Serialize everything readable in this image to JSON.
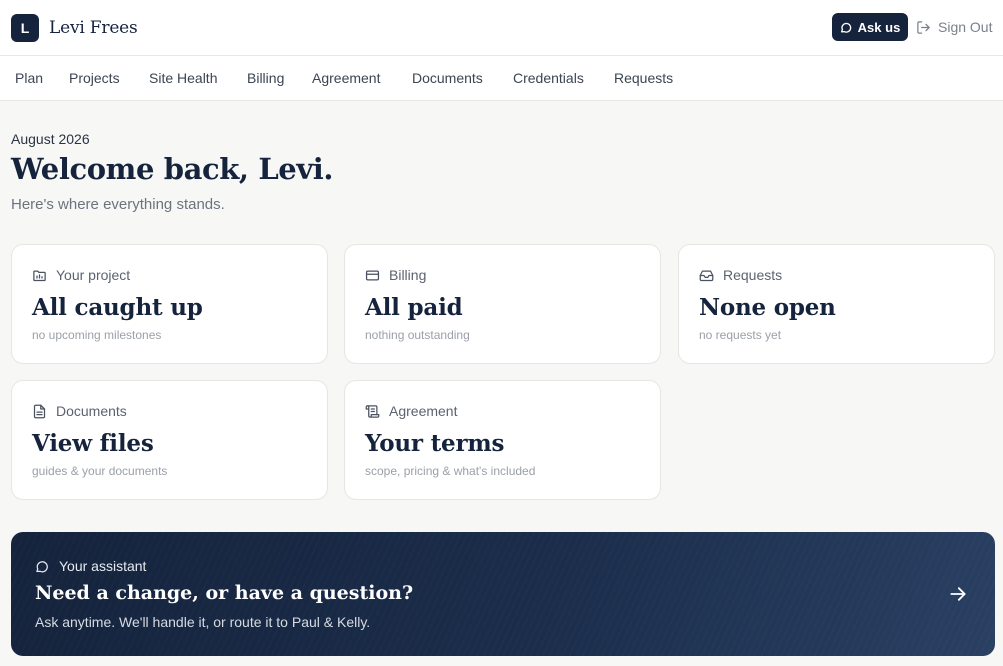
{
  "brand": {
    "initial": "L",
    "name": "Levi Frees"
  },
  "header": {
    "ask_label": "Ask us",
    "signout_label": "Sign Out"
  },
  "nav": [
    "Plan",
    "Projects",
    "Site Health",
    "Billing",
    "Agreement",
    "Documents",
    "Credentials",
    "Requests"
  ],
  "hero": {
    "date": "August 2026",
    "welcome": "Welcome back, Levi.",
    "subtitle": "Here's where everything stands."
  },
  "cards": [
    {
      "label": "Your project",
      "title": "All caught up",
      "sub": "no upcoming milestones",
      "icon": "folder-icon"
    },
    {
      "label": "Billing",
      "title": "All paid",
      "sub": "nothing outstanding",
      "icon": "credit-card-icon"
    },
    {
      "label": "Requests",
      "title": "None open",
      "sub": "no requests yet",
      "icon": "inbox-icon"
    },
    {
      "label": "Documents",
      "title": "View files",
      "sub": "guides & your documents",
      "icon": "document-icon"
    },
    {
      "label": "Agreement",
      "title": "Your terms",
      "sub": "scope, pricing & what's included",
      "icon": "scroll-icon"
    }
  ],
  "assistant": {
    "label": "Your assistant",
    "title": "Need a change, or have a question?",
    "subtitle": "Ask anytime. We'll handle it, or route it to Paul & Kelly."
  },
  "colors": {
    "navy": "#15233c",
    "background": "#f7f7f6",
    "card": "#ffffff",
    "muted": "#9ba0a8"
  }
}
